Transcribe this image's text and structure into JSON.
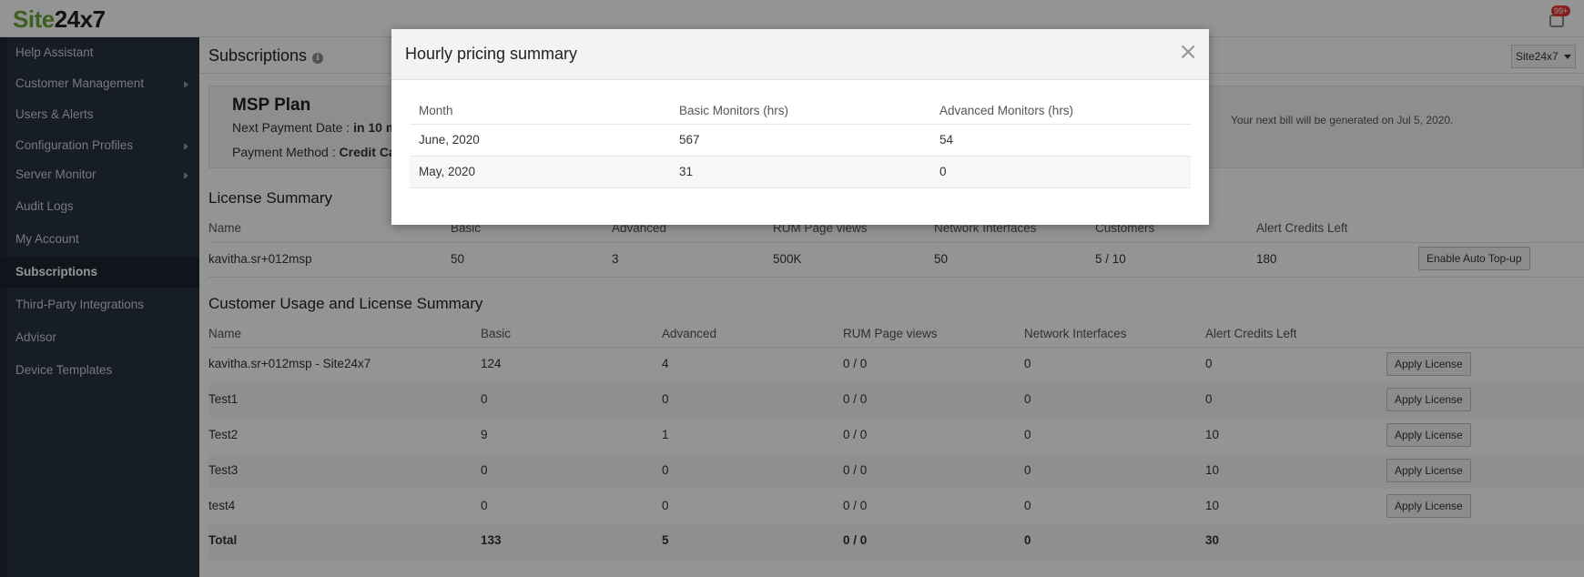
{
  "app": {
    "logo_part1": "Site",
    "logo_part2": "24x7",
    "notification_count": "99+",
    "account_selector": "Site24x7"
  },
  "sidebar": {
    "items": [
      {
        "label": "Help Assistant",
        "has_submenu": false,
        "active": false
      },
      {
        "label": "Customer Management",
        "has_submenu": true,
        "active": false
      },
      {
        "label": "Users & Alerts",
        "has_submenu": false,
        "active": false
      },
      {
        "label": "Configuration Profiles",
        "has_submenu": true,
        "active": false
      },
      {
        "label": "Server Monitor",
        "has_submenu": true,
        "active": false
      },
      {
        "label": "Audit Logs",
        "has_submenu": false,
        "active": false
      },
      {
        "label": "My Account",
        "has_submenu": false,
        "active": false
      },
      {
        "label": "Subscriptions",
        "has_submenu": false,
        "active": true
      },
      {
        "label": "Third-Party Integrations",
        "has_submenu": false,
        "active": false
      },
      {
        "label": "Advisor",
        "has_submenu": false,
        "active": false
      },
      {
        "label": "Device Templates",
        "has_submenu": false,
        "active": false
      }
    ]
  },
  "page": {
    "title": "Subscriptions",
    "plan": {
      "name": "MSP Plan",
      "next_payment_label": "Next Payment Date :",
      "next_payment_value": "in 10 m",
      "payment_method_label": "Payment Method :",
      "payment_method_value": "Credit Ca",
      "next_bill_note": "Your next bill will be generated on Jul 5, 2020."
    },
    "license_summary": {
      "title": "License Summary",
      "headers": [
        "Name",
        "Basic",
        "Advanced",
        "RUM Page views",
        "Network Interfaces",
        "Customers",
        "Alert Credits Left"
      ],
      "row": [
        "kavitha.sr+012msp",
        "50",
        "3",
        "500K",
        "50",
        "5 / 10",
        "180"
      ],
      "button": "Enable Auto Top-up"
    },
    "customer_usage": {
      "title": "Customer Usage and License Summary",
      "headers": [
        "Name",
        "Basic",
        "Advanced",
        "RUM Page views",
        "Network Interfaces",
        "Alert Credits Left"
      ],
      "rows": [
        [
          "kavitha.sr+012msp - Site24x7",
          "124",
          "4",
          "0 / 0",
          "0",
          "0"
        ],
        [
          "Test1",
          "0",
          "0",
          "0 / 0",
          "0",
          "0"
        ],
        [
          "Test2",
          "9",
          "1",
          "0 / 0",
          "0",
          "10"
        ],
        [
          "Test3",
          "0",
          "0",
          "0 / 0",
          "0",
          "10"
        ],
        [
          "test4",
          "0",
          "0",
          "0 / 0",
          "0",
          "10"
        ]
      ],
      "row_button": "Apply License",
      "total": [
        "Total",
        "133",
        "5",
        "0 / 0",
        "0",
        "30"
      ]
    }
  },
  "modal": {
    "title": "Hourly pricing summary",
    "close_glyph": "×",
    "headers": [
      "Month",
      "Basic Monitors (hrs)",
      "Advanced Monitors (hrs)"
    ],
    "rows": [
      [
        "June, 2020",
        "567",
        "54"
      ],
      [
        "May, 2020",
        "31",
        "0"
      ]
    ]
  }
}
